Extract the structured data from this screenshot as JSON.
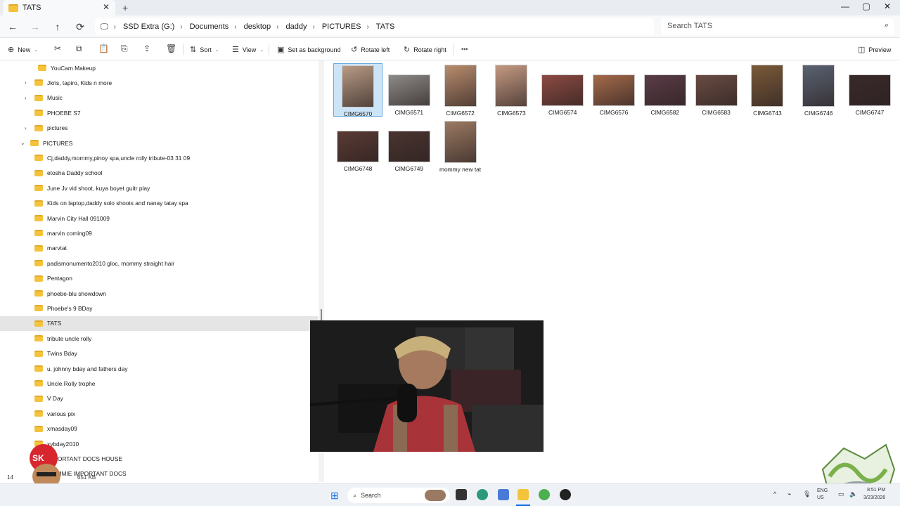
{
  "tab": {
    "title": "TATS",
    "close": "✕",
    "new": "+"
  },
  "window_controls": {
    "minimize": "—",
    "maximize": "▢",
    "close": "✕"
  },
  "nav": {
    "back": "←",
    "forward": "→",
    "up": "↑",
    "refresh": "⟳"
  },
  "breadcrumb": {
    "items": [
      "SSD Extra (G:)",
      "Documents",
      "desktop",
      "daddy",
      "PICTURES",
      "TATS"
    ],
    "sep": "›"
  },
  "search": {
    "placeholder": "Search TATS",
    "icon": "search-icon"
  },
  "toolbar": {
    "new_label": "New",
    "sort_label": "Sort",
    "view_label": "View",
    "set_bg_label": "Set as background",
    "rotate_left_label": "Rotate left",
    "rotate_right_label": "Rotate right",
    "more_label": "•••",
    "preview_label": "Preview"
  },
  "nav_tree": [
    {
      "label": "YouCam Makeup",
      "indent": 2,
      "chevron": ""
    },
    {
      "label": "Jkris, tapiro, Kids n more",
      "indent": 1,
      "chevron": "›"
    },
    {
      "label": "Music",
      "indent": 1,
      "chevron": "›"
    },
    {
      "label": "PHOEBE S7",
      "indent": 1,
      "chevron": ""
    },
    {
      "label": "pictures",
      "indent": 1,
      "chevron": "›"
    },
    {
      "label": "PICTURES",
      "indent": 0,
      "chevron": "⌄"
    },
    {
      "label": "Cj,daddy,mommy,pinoy spa,uncle rolly tribute-03 31 09",
      "indent": 1,
      "chevron": ""
    },
    {
      "label": "etosha Daddy school",
      "indent": 1,
      "chevron": ""
    },
    {
      "label": "June Jv vid shoot, kuya boyet guitr play",
      "indent": 1,
      "chevron": ""
    },
    {
      "label": "Kids on laptop,daddy solo shoots and nanay tatay spa",
      "indent": 1,
      "chevron": ""
    },
    {
      "label": "Marvin City Hall 091009",
      "indent": 1,
      "chevron": ""
    },
    {
      "label": "marvin coming09",
      "indent": 1,
      "chevron": ""
    },
    {
      "label": "marvtat",
      "indent": 1,
      "chevron": ""
    },
    {
      "label": "padismonumento2010 gloc, mommy straight hair",
      "indent": 1,
      "chevron": ""
    },
    {
      "label": "Pentagon",
      "indent": 1,
      "chevron": ""
    },
    {
      "label": "phoebe-blu showdown",
      "indent": 1,
      "chevron": ""
    },
    {
      "label": "Phoebe's 9 BDay",
      "indent": 1,
      "chevron": ""
    },
    {
      "label": "TATS",
      "indent": 1,
      "chevron": "",
      "selected": true
    },
    {
      "label": "tribute uncle rolly",
      "indent": 1,
      "chevron": ""
    },
    {
      "label": "Twins Bday",
      "indent": 1,
      "chevron": ""
    },
    {
      "label": "u. johnny bday and fathers day",
      "indent": 1,
      "chevron": ""
    },
    {
      "label": "Uncle Rolly trophe",
      "indent": 1,
      "chevron": ""
    },
    {
      "label": "V Day",
      "indent": 1,
      "chevron": ""
    },
    {
      "label": "various pix",
      "indent": 1,
      "chevron": ""
    },
    {
      "label": "xmasday09",
      "indent": 1,
      "chevron": ""
    },
    {
      "label": "xybday2010",
      "indent": 1,
      "chevron": ""
    },
    {
      "label": "IMPORTANT DOCS HOUSE",
      "indent": 1,
      "chevron": ""
    },
    {
      "label": "MOMMIE IMPORTANT DOCS",
      "indent": 1,
      "chevron": ""
    }
  ],
  "files": [
    {
      "name": "CIMG6570",
      "selected": true,
      "color": "#b89a84",
      "shape": "portrait"
    },
    {
      "name": "CIMG6571",
      "color": "#8d8a88",
      "shape": "landscape"
    },
    {
      "name": "CIMG6572",
      "color": "#b88c6d",
      "shape": "portrait"
    },
    {
      "name": "CIMG6573",
      "color": "#c49a82",
      "shape": "portrait"
    },
    {
      "name": "CIMG6574",
      "color": "#8c4a42",
      "shape": "landscape"
    },
    {
      "name": "CIMG6576",
      "color": "#a46a4a",
      "shape": "landscape"
    },
    {
      "name": "CIMG6582",
      "color": "#5a3c46",
      "shape": "landscape"
    },
    {
      "name": "CIMG6583",
      "color": "#6a4c42",
      "shape": "landscape"
    },
    {
      "name": "CIMG6743",
      "color": "#7a5a3a",
      "shape": "portrait"
    },
    {
      "name": "CIMG6746",
      "color": "#5a6272",
      "shape": "portrait"
    },
    {
      "name": "CIMG6747",
      "color": "#3a2a2a",
      "shape": "landscape"
    },
    {
      "name": "CIMG6748",
      "color": "#5a3a34",
      "shape": "landscape"
    },
    {
      "name": "CIMG6749",
      "color": "#4a3430",
      "shape": "landscape"
    },
    {
      "name": "mommy new tat",
      "color": "#9a7a62",
      "shape": "portrait"
    }
  ],
  "status": {
    "count": "14",
    "size": "651 KB"
  },
  "taskbar": {
    "search_label": "Search",
    "lang_top": "ENG",
    "lang_bottom": "US",
    "time": "8:51 PM",
    "date": "3/23/2026"
  }
}
